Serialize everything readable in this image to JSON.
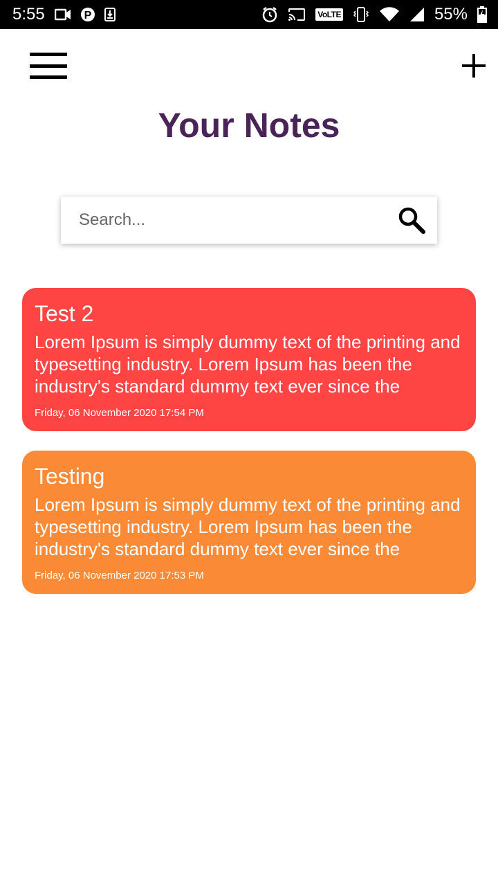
{
  "status_bar": {
    "time": "5:55",
    "volte": "VoLTE",
    "battery": "55%"
  },
  "header": {
    "title": "Your Notes",
    "menu_icon": "hamburger-menu-icon",
    "add_icon": "plus-icon"
  },
  "search": {
    "placeholder": "Search...",
    "icon": "search-icon"
  },
  "notes": [
    {
      "title": "Test 2",
      "body": "Lorem Ipsum is simply dummy text of the printing and typesetting industry. Lorem Ipsum has been the industry's standard dummy text ever since the",
      "date": "Friday, 06 November 2020 17:54 PM",
      "color": "#fe4544"
    },
    {
      "title": "Testing",
      "body": "Lorem Ipsum is simply dummy text of the printing and typesetting industry. Lorem Ipsum has been the industry's standard dummy text ever since the",
      "date": "Friday, 06 November 2020 17:53 PM",
      "color": "#fa8a35"
    }
  ],
  "colors": {
    "title": "#4a2459",
    "status_bar": "#000000"
  }
}
